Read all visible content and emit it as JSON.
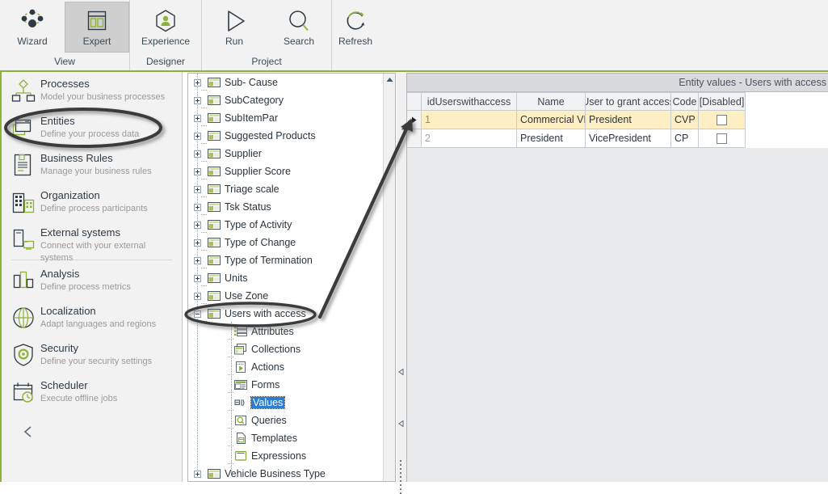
{
  "ribbon": {
    "groups": [
      {
        "label": "View",
        "buttons": [
          {
            "label": "Wizard",
            "icon": "network-nodes-icon",
            "active": false
          },
          {
            "label": "Expert",
            "icon": "layout-panels-icon",
            "active": true
          }
        ]
      },
      {
        "label": "Designer",
        "buttons": [
          {
            "label": "Experience",
            "icon": "user-hexagon-icon",
            "active": false
          }
        ]
      },
      {
        "label": "Project",
        "buttons": [
          {
            "label": "Run",
            "icon": "play-triangle-icon",
            "active": false
          },
          {
            "label": "Search",
            "icon": "magnifier-icon",
            "active": false
          }
        ]
      },
      {
        "label": "",
        "buttons": [
          {
            "label": "Refresh",
            "icon": "refresh-circular-arrow-icon",
            "active": false
          }
        ]
      }
    ]
  },
  "sidebar": {
    "items": [
      {
        "title": "Processes",
        "subtitle": "Model your business processes",
        "icon": "process-flow-icon"
      },
      {
        "title": "Entities",
        "subtitle": "Define your process data",
        "icon": "entities-window-icon"
      },
      {
        "title": "Business Rules",
        "subtitle": "Manage your business rules",
        "icon": "rules-document-icon"
      },
      {
        "title": "Organization",
        "subtitle": "Define process participants",
        "icon": "organization-building-icon"
      },
      {
        "title": "External systems",
        "subtitle": "Connect with your external systems",
        "icon": "external-systems-icon"
      },
      {
        "title": "Analysis",
        "subtitle": "Define process metrics",
        "icon": "analysis-bars-icon"
      },
      {
        "title": "Localization",
        "subtitle": "Adapt languages and regions",
        "icon": "globe-icon"
      },
      {
        "title": "Security",
        "subtitle": "Define your security settings",
        "icon": "shield-gear-icon"
      },
      {
        "title": "Scheduler",
        "subtitle": "Execute offline jobs",
        "icon": "calendar-clock-icon"
      }
    ],
    "collapse_icon": "chevron-left-icon"
  },
  "tree": {
    "nodes": [
      {
        "label": "Sub- Cause",
        "level": 0,
        "expander": "plus",
        "icon": "entity-table-icon"
      },
      {
        "label": "SubCategory",
        "level": 0,
        "expander": "plus",
        "icon": "entity-table-icon"
      },
      {
        "label": "SubItemPar",
        "level": 0,
        "expander": "plus",
        "icon": "entity-table-icon"
      },
      {
        "label": "Suggested Products",
        "level": 0,
        "expander": "plus",
        "icon": "entity-table-icon"
      },
      {
        "label": "Supplier",
        "level": 0,
        "expander": "plus",
        "icon": "entity-table-icon"
      },
      {
        "label": "Supplier Score",
        "level": 0,
        "expander": "plus",
        "icon": "entity-table-icon"
      },
      {
        "label": "Triage scale",
        "level": 0,
        "expander": "plus",
        "icon": "entity-table-icon"
      },
      {
        "label": "Tsk Status",
        "level": 0,
        "expander": "plus",
        "icon": "entity-table-icon"
      },
      {
        "label": "Type of Activity",
        "level": 0,
        "expander": "plus",
        "icon": "entity-table-icon"
      },
      {
        "label": "Type of Change",
        "level": 0,
        "expander": "plus",
        "icon": "entity-table-icon"
      },
      {
        "label": "Type of Termination",
        "level": 0,
        "expander": "plus",
        "icon": "entity-table-icon"
      },
      {
        "label": "Units",
        "level": 0,
        "expander": "plus",
        "icon": "entity-table-icon"
      },
      {
        "label": "Use Zone",
        "level": 0,
        "expander": "plus",
        "icon": "entity-table-icon"
      },
      {
        "label": "Users with access",
        "level": 0,
        "expander": "minus",
        "icon": "entity-table-icon"
      },
      {
        "label": "Attributes",
        "level": 1,
        "expander": "none",
        "icon": "attributes-list-icon"
      },
      {
        "label": "Collections",
        "level": 1,
        "expander": "none",
        "icon": "collections-icon"
      },
      {
        "label": "Actions",
        "level": 1,
        "expander": "none",
        "icon": "actions-play-icon"
      },
      {
        "label": "Forms",
        "level": 1,
        "expander": "none",
        "icon": "forms-icon"
      },
      {
        "label": "Values",
        "level": 1,
        "expander": "none",
        "icon": "values-icon",
        "selected": true
      },
      {
        "label": "Queries",
        "level": 1,
        "expander": "none",
        "icon": "queries-search-icon"
      },
      {
        "label": "Templates",
        "level": 1,
        "expander": "none",
        "icon": "templates-icon"
      },
      {
        "label": "Expressions",
        "level": 1,
        "expander": "none",
        "icon": "expressions-icon"
      },
      {
        "label": "Vehicle Business Type",
        "level": 0,
        "expander": "plus",
        "icon": "entity-table-icon"
      }
    ],
    "scroll_up_icon": "scroll-up-arrow-icon"
  },
  "splitter": {
    "collapse_left_icon": "collapse-arrow-icon",
    "collapse_left_icon2": "collapse-arrow-icon",
    "grip": "splitter-grip"
  },
  "grid": {
    "caption": "Entity values - Users with access",
    "columns": [
      "idUserswithaccess",
      "Name",
      "User to grant access",
      "Code",
      "[Disabled]"
    ],
    "rows": [
      {
        "id": "1",
        "name": "Commercial VP",
        "user": "President",
        "code": "CVP",
        "disabled": false,
        "selected": true,
        "indicator": "row-selector-arrow-icon"
      },
      {
        "id": "2",
        "name": "President",
        "user": "VicePresident",
        "code": "CP",
        "disabled": false,
        "selected": false,
        "indicator": ""
      }
    ]
  },
  "annotations": {
    "ellipse_entities": "highlight-ellipse-entities",
    "ellipse_users_with_access": "highlight-ellipse-users-with-access",
    "arrow": "annotation-arrow"
  },
  "colors": {
    "accent_green": "#8cb23c",
    "selection_blue": "#2a7fd4",
    "row_highlight": "#fdeec4",
    "ink": "#2e3a44",
    "annotation": "#3a3a3a"
  }
}
